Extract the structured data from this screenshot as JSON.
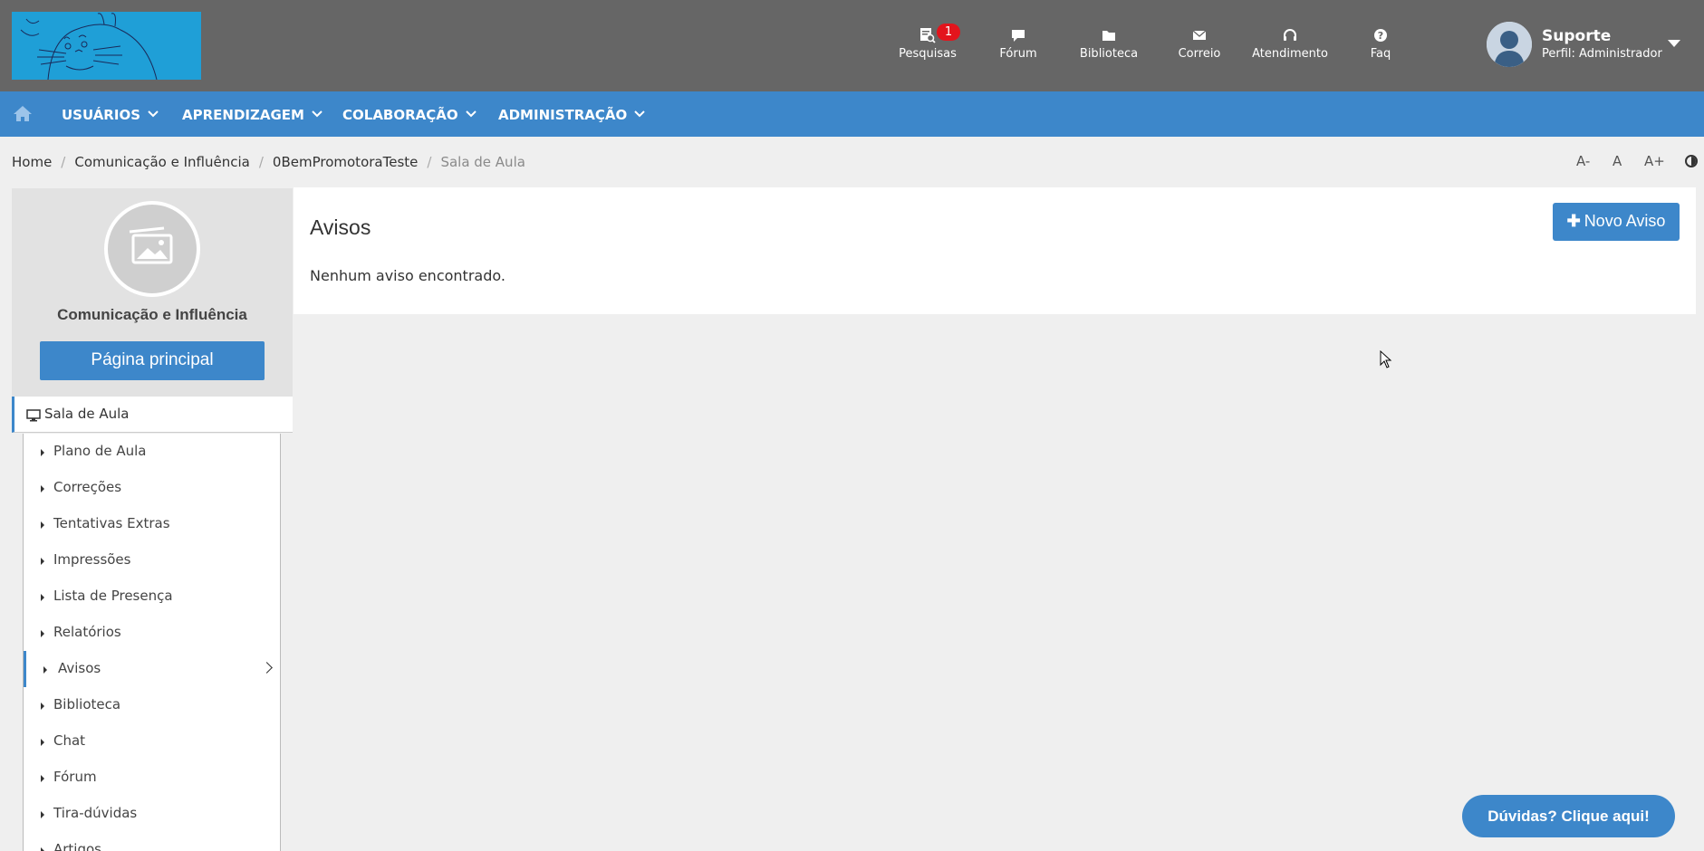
{
  "header": {
    "nav": [
      {
        "label": "Pesquisas",
        "icon": "survey-icon",
        "badge": "1"
      },
      {
        "label": "Fórum",
        "icon": "chat-bubble-icon"
      },
      {
        "label": "Biblioteca",
        "icon": "folder-icon"
      },
      {
        "label": "Correio",
        "icon": "envelope-icon"
      },
      {
        "label": "Atendimento",
        "icon": "headset-icon"
      },
      {
        "label": "Faq",
        "icon": "question-circle-icon"
      }
    ],
    "user": {
      "name": "Suporte",
      "profile": "Perfil: Administrador"
    }
  },
  "mainnav": {
    "items": [
      {
        "label": "USUÁRIOS"
      },
      {
        "label": "APRENDIZAGEM"
      },
      {
        "label": "COLABORAÇÃO"
      },
      {
        "label": "ADMINISTRAÇÃO"
      }
    ]
  },
  "breadcrumb": {
    "items": [
      "Home",
      "Comunicação e Influência",
      "0BemPromotoraTeste"
    ],
    "current": "Sala de Aula"
  },
  "font_controls": {
    "decrease": "A-",
    "normal": "A",
    "increase": "A+"
  },
  "sidebar": {
    "course_title": "Comunicação e Influência",
    "main_page_label": "Página principal",
    "section_label": "Sala de Aula",
    "items": [
      {
        "label": "Plano de Aula"
      },
      {
        "label": "Correções"
      },
      {
        "label": "Tentativas Extras"
      },
      {
        "label": "Impressões"
      },
      {
        "label": "Lista de Presença"
      },
      {
        "label": "Relatórios"
      },
      {
        "label": "Avisos"
      },
      {
        "label": "Biblioteca"
      },
      {
        "label": "Chat"
      },
      {
        "label": "Fórum"
      },
      {
        "label": "Tira-dúvidas"
      },
      {
        "label": "Artigos"
      }
    ],
    "active_index": 6
  },
  "content": {
    "title": "Avisos",
    "empty_message": "Nenhum aviso encontrado.",
    "new_button_label": "Novo Aviso"
  },
  "help_button_label": "Dúvidas? Clique aqui!",
  "colors": {
    "topbar": "#666666",
    "accent": "#3d87ca",
    "badge": "#e3141c",
    "background": "#efefef"
  }
}
